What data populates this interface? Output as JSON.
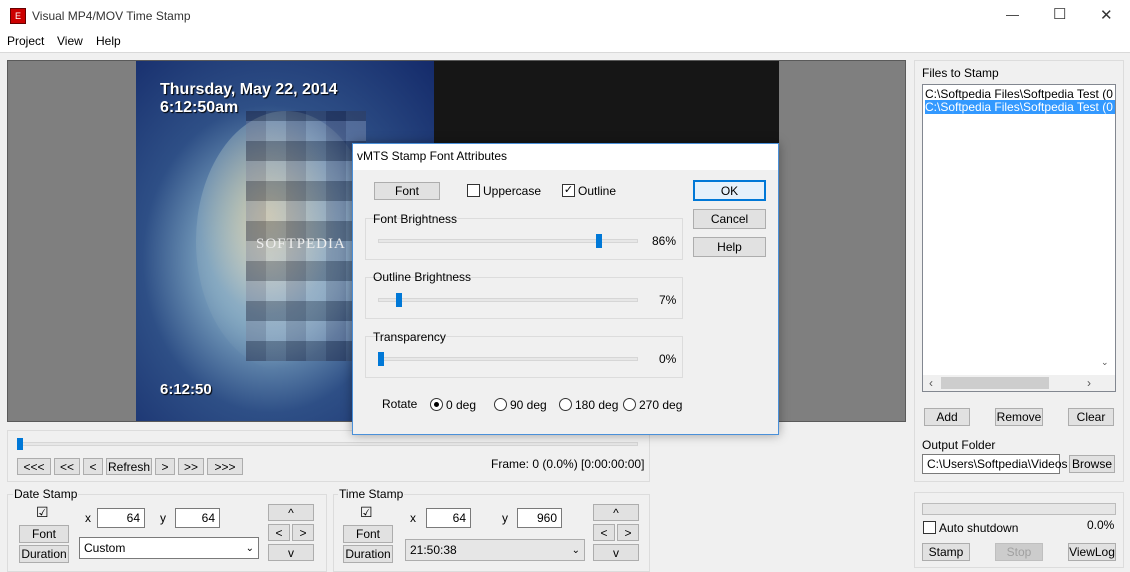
{
  "window": {
    "title": "Visual MP4/MOV Time Stamp",
    "minimize": "—",
    "maximize": "☐",
    "close": "✕"
  },
  "menu": [
    "Project",
    "View",
    "Help"
  ],
  "video": {
    "date_text": "Thursday, May 22, 2014",
    "time_text": "6:12:50am",
    "bottom_time": "6:12:50",
    "watermark": "SOFTPEDIA"
  },
  "playback": {
    "buttons": [
      "<<<",
      "<<",
      "<",
      "Refresh",
      ">",
      ">>",
      ">>>"
    ],
    "frame_label": "Frame: 0 (0.0%) [0:00:00:00]",
    "progress": 0
  },
  "date_stamp": {
    "title": "Date Stamp",
    "checked": "☑",
    "font_label": "Font",
    "duration_label": "Duration",
    "x_label": "x",
    "x_value": "64",
    "y_label": "y",
    "y_value": "64",
    "format": "Custom",
    "up": "^",
    "left": "<",
    "right": ">",
    "down": "v"
  },
  "time_stamp": {
    "title": "Time Stamp",
    "checked": "☑",
    "font_label": "Font",
    "duration_label": "Duration",
    "x_label": "x",
    "x_value": "64",
    "y_label": "y",
    "y_value": "960",
    "format": "21:50:38",
    "up": "^",
    "left": "<",
    "right": ">",
    "down": "v"
  },
  "files": {
    "title": "Files to Stamp",
    "items": [
      "C:\\Softpedia Files\\Softpedia Test (0",
      "C:\\Softpedia Files\\Softpedia Test (0"
    ],
    "add": "Add",
    "remove": "Remove",
    "clear": "Clear",
    "output_label": "Output Folder",
    "output_value": "C:\\Users\\Softpedia\\Videos",
    "browse": "Browse"
  },
  "process": {
    "auto_shutdown": "Auto shutdown",
    "percent": "0.0%",
    "progress": 0,
    "stamp": "Stamp",
    "stop": "Stop",
    "viewlog": "ViewLog"
  },
  "dialog": {
    "title": "vMTS Stamp Font Attributes",
    "font_button": "Font",
    "uppercase": "Uppercase",
    "outline": "Outline",
    "ok": "OK",
    "cancel": "Cancel",
    "help": "Help",
    "font_brightness_label": "Font Brightness",
    "font_brightness": "86%",
    "font_brightness_value": 0.86,
    "outline_brightness_label": "Outline Brightness",
    "outline_brightness": "7%",
    "outline_brightness_value": 0.07,
    "transparency_label": "Transparency",
    "transparency": "0%",
    "transparency_value": 0.0,
    "rotate_label": "Rotate",
    "rotations": [
      "0 deg",
      "90 deg",
      "180 deg",
      "270 deg"
    ]
  },
  "colors": {
    "accent": "#0078d7",
    "selection": "#3399ff",
    "video_bg": "#7f7f7f"
  }
}
